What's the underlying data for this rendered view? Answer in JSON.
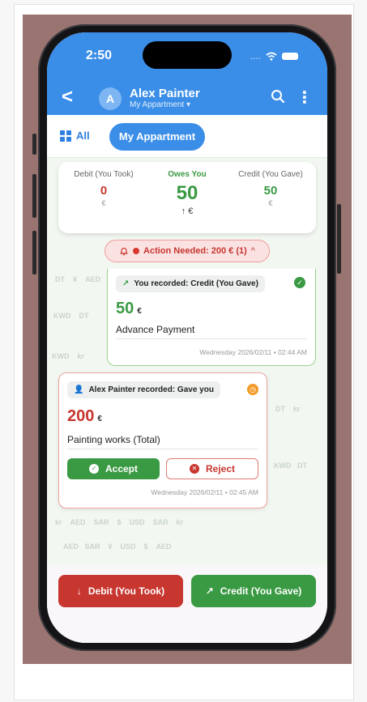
{
  "status": {
    "time": "2:50",
    "carrier_dots": "...."
  },
  "header": {
    "back_glyph": "<",
    "avatar_letter": "A",
    "name": "Alex Painter",
    "subtitle": "My Appartment ▾",
    "more_glyph": "⋮"
  },
  "filters": {
    "all_label": "All",
    "active_chip": "My Appartment"
  },
  "summary": {
    "debit": {
      "label": "Debit (You Took)",
      "amount": "0",
      "currency": "€"
    },
    "owes": {
      "label": "Owes You",
      "amount": "50",
      "currency": "↑ €"
    },
    "credit": {
      "label": "Credit (You Gave)",
      "amount": "50",
      "currency": "€"
    }
  },
  "action_needed": {
    "label": "Action Needed: 200 € (1)",
    "chevron": "^"
  },
  "entry1": {
    "tag": "You recorded: Credit (You Gave)",
    "amount": "50",
    "currency": "€",
    "description": "Advance Payment",
    "timestamp": "Wednesday 2026/02/11 • 02:44 AM"
  },
  "entry2": {
    "tag": "Alex Painter recorded: Gave you",
    "amount": "200",
    "currency": "€",
    "description": "Painting works (Total)",
    "accept": "Accept",
    "reject": "Reject",
    "timestamp": "Wednesday 2026/02/11 • 02:45 AM"
  },
  "bottom": {
    "debit_label": "Debit (You Took)",
    "credit_label": "Credit (You Gave)"
  },
  "colors": {
    "primary": "#3b8ee8",
    "green": "#3a9a43",
    "red": "#c7362f",
    "orange": "#f39a27"
  }
}
